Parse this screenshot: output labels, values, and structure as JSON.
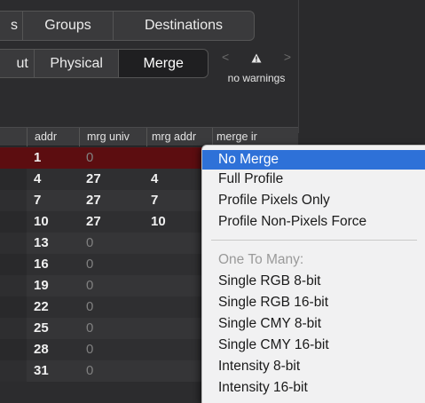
{
  "tabs": {
    "partial": "s",
    "groups": "Groups",
    "destinations": "Destinations"
  },
  "subtabs": {
    "partial": "ut",
    "physical": "Physical",
    "merge": "Merge"
  },
  "warnings": {
    "text": "no warnings",
    "prev": "<",
    "next": ">"
  },
  "table": {
    "columns": [
      "addr",
      "mrg univ",
      "mrg addr",
      "merge ir"
    ],
    "rows": [
      {
        "addr": "1",
        "mrg_univ": "0",
        "mrg_addr": "",
        "selected": true
      },
      {
        "addr": "4",
        "mrg_univ": "27",
        "mrg_addr": "4"
      },
      {
        "addr": "7",
        "mrg_univ": "27",
        "mrg_addr": "7"
      },
      {
        "addr": "10",
        "mrg_univ": "27",
        "mrg_addr": "10"
      },
      {
        "addr": "13",
        "mrg_univ": "0",
        "mrg_addr": ""
      },
      {
        "addr": "16",
        "mrg_univ": "0",
        "mrg_addr": ""
      },
      {
        "addr": "19",
        "mrg_univ": "0",
        "mrg_addr": ""
      },
      {
        "addr": "22",
        "mrg_univ": "0",
        "mrg_addr": ""
      },
      {
        "addr": "25",
        "mrg_univ": "0",
        "mrg_addr": ""
      },
      {
        "addr": "28",
        "mrg_univ": "0",
        "mrg_addr": ""
      },
      {
        "addr": "31",
        "mrg_univ": "0",
        "mrg_addr": ""
      }
    ]
  },
  "menu": {
    "items": [
      {
        "label": "No Merge",
        "highlighted": true
      },
      {
        "label": "Full Profile"
      },
      {
        "label": "Profile Pixels Only"
      },
      {
        "label": "Profile Non-Pixels Force"
      }
    ],
    "section_header": "One To Many:",
    "section_items": [
      {
        "label": "Single RGB 8-bit"
      },
      {
        "label": "Single RGB 16-bit"
      },
      {
        "label": "Single CMY 8-bit"
      },
      {
        "label": "Single CMY 16-bit"
      },
      {
        "label": "Intensity 8-bit"
      },
      {
        "label": "Intensity 16-bit"
      }
    ]
  },
  "colors": {
    "accent": "#2e71d8",
    "selected_row": "#5c0d10",
    "dim_value": "#808080"
  },
  "icons": {
    "warning": "warning-triangle-icon"
  }
}
